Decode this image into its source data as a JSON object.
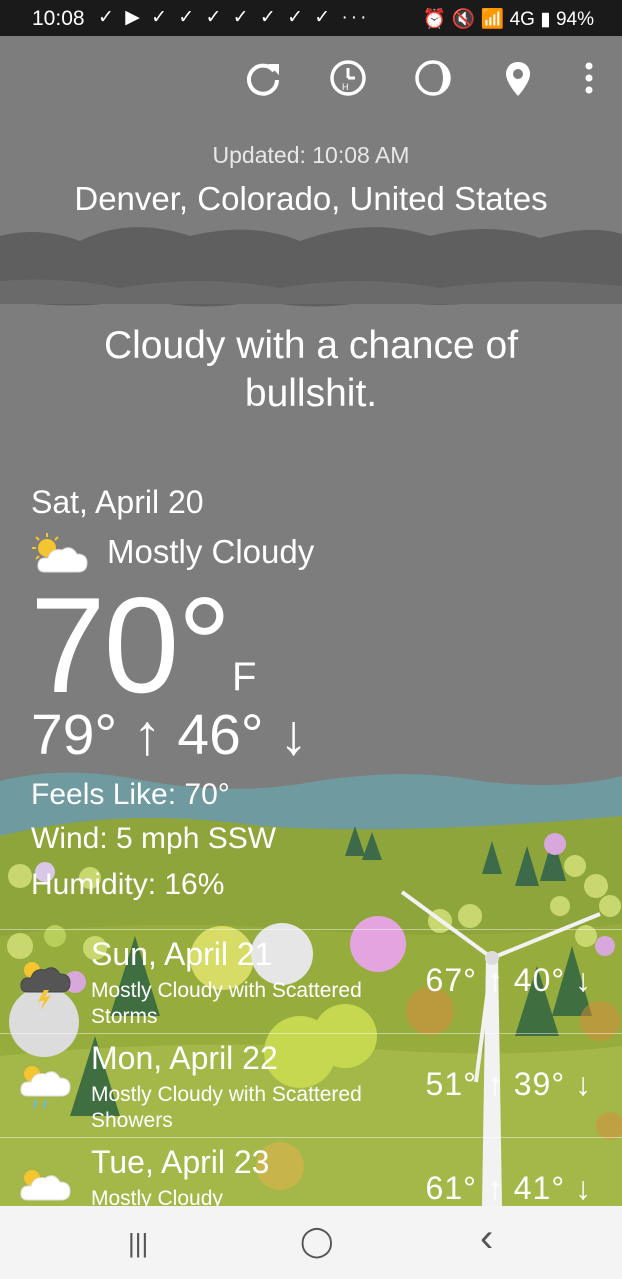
{
  "status_bar": {
    "time": "10:08",
    "notification_icons": "✓ ▶ ✓ ✓ ✓ ✓ ✓ ✓ ✓ ···",
    "right_icons": "⏰ 🔇 📶 4G ▮",
    "battery": "94%"
  },
  "toolbar": {
    "icons": [
      "refresh-icon",
      "history-icon",
      "moon-phase-icon",
      "location-pin-icon",
      "more-vert-icon"
    ]
  },
  "header": {
    "updated": "Updated: 10:08 AM",
    "location": "Denver, Colorado, United States"
  },
  "tagline": "Cloudy with a chance of bullshit.",
  "current": {
    "date": "Sat, April 20",
    "condition": "Mostly Cloudy",
    "temp": "70°",
    "unit": "F",
    "hilo": "79° ↑ 46° ↓",
    "feels_like": "Feels Like: 70°",
    "wind": "Wind: 5 mph SSW",
    "humidity": "Humidity: 16%"
  },
  "forecast": [
    {
      "day": "Sun, April 21",
      "condition": "Mostly Cloudy with Scattered Storms",
      "temps": "67° ↑ 40° ↓",
      "icon": "storm-icon"
    },
    {
      "day": "Mon, April 22",
      "condition": "Mostly Cloudy with Scattered Showers",
      "temps": "51° ↑ 39° ↓",
      "icon": "showers-icon"
    },
    {
      "day": "Tue, April 23",
      "condition": "Mostly Cloudy",
      "temps": "61° ↑ 41° ↓",
      "icon": "partly-cloudy-icon"
    }
  ],
  "nav_bar": {
    "recents": "|||",
    "home": "◯",
    "back": "‹"
  },
  "colors": {
    "sky": "#7d7d7d",
    "cloud_band": "#5f5f5f",
    "mountain": "#6f9aa0",
    "grass": "#8da53a",
    "pine": "#3d6b4a"
  }
}
